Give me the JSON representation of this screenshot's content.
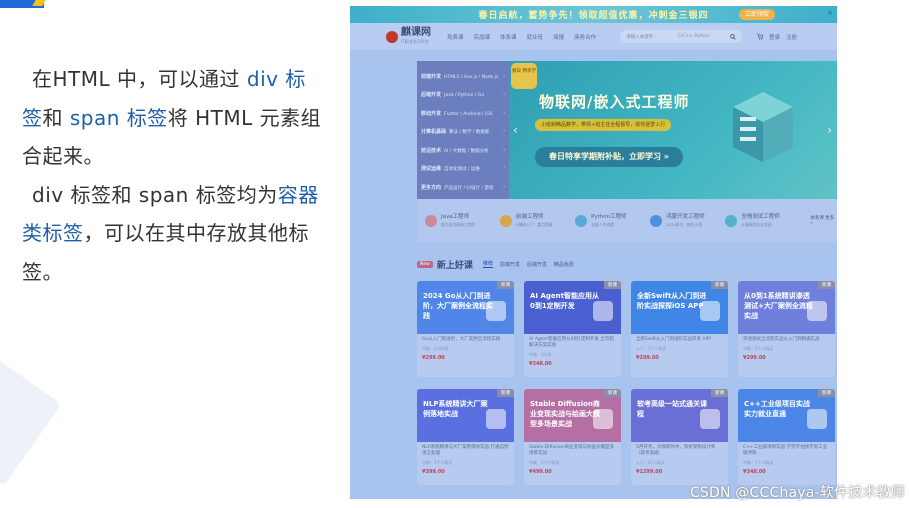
{
  "text_block": {
    "p1_a": "在HTML 中，可以通过 ",
    "p1_div": "div 标签",
    "p1_b": "和 ",
    "p1_span": "span 标签",
    "p1_c": "将 HTML 元素组合起来。",
    "p2_a": "div 标签和 span 标签均为",
    "p2_hl": "容器类标签",
    "p2_b": "，可以在其中存放其他标签。"
  },
  "screenshot": {
    "promo": {
      "text": "春日启航，蓄势争先！领取超值优惠，冲刺金三银四",
      "button": "立即领取",
      "close": "×"
    },
    "nav": {
      "logo": "麒课网",
      "logo_sub": "IT职业学习平台",
      "items": [
        "免费课",
        "实战课",
        "体系课",
        "就业班",
        "简报",
        "商务合作"
      ],
      "search_placeholder": "请输入关键字...",
      "search_hint": "C/C++ Python",
      "right": [
        "登录",
        "注册"
      ]
    },
    "side_menu": [
      {
        "title": "前端开发",
        "sub": "HTML5 / Vue.js / Node.js"
      },
      {
        "title": "后端开发",
        "sub": "Java / Python / Go"
      },
      {
        "title": "移动开发",
        "sub": "Flutter / Android / iOS"
      },
      {
        "title": "计算机基础",
        "sub": "算法 / 数学 / 数据库"
      },
      {
        "title": "前沿技术",
        "sub": "AI / 大数据 / 数据分析"
      },
      {
        "title": "测试运维",
        "sub": "自动化测试 / 运维"
      },
      {
        "title": "更多方向",
        "sub": "产品设计 / UI设计 / 游戏"
      }
    ],
    "banner": {
      "badge": "春日 特享学",
      "title": "物联网/嵌入式工程师",
      "subtitle": "小班制精品教学，带领+班主任全程督导，助你逐梦入行",
      "button": "春日特享学期附补贴，立即学习 »",
      "arrow_left": "‹",
      "arrow_right": "›"
    },
    "categories": [
      {
        "title": "Java工程师",
        "sub": "助力成为高级工程师",
        "color": "#c98a9e"
      },
      {
        "title": "前端工程师",
        "sub": "0基础入门 · 重点提高",
        "color": "#d9a54b"
      },
      {
        "title": "Python工程师",
        "sub": "全能人才成就",
        "color": "#5aa7d8"
      },
      {
        "title": "鸿蒙开发工程师",
        "sub": "2024风口 · 抢先入局",
        "color": "#4f8fe0"
      },
      {
        "title": "全栈测试工程师",
        "sub": "从基础到企业实战",
        "color": "#4fb3c9"
      }
    ],
    "categories_more": "体系课 更多 »",
    "section": {
      "tag": "New",
      "title": "新上好课",
      "tabs": [
        "推荐",
        "前端开发",
        "后端开发",
        "精品免费"
      ]
    },
    "cards": [
      {
        "title": "2024 Go从入门到进阶，大厂案例全流程实践",
        "desc": "Go从入门到进阶，大厂案例全流程实践",
        "meta": "中级 · 2小时前",
        "price": "¥299.00",
        "badge": "新课",
        "color": "#4f86e8"
      },
      {
        "title": "AI Agent智能应用从0到1定制开发",
        "desc": "AI Agent智能应用从0到1定制开发 全流程解决方案实践",
        "meta": "中级 · 1天前",
        "price": "¥348.00",
        "badge": "新课",
        "color": "#4a5fd0"
      },
      {
        "title": "全新Swift从入门到进阶实战探探iOS APP",
        "desc": "全新Swift从入门到进阶实战开发 APP",
        "meta": "入门 · 1个人购买",
        "price": "¥299.00",
        "badge": "新课",
        "color": "#3f86e6"
      },
      {
        "title": "从0到1系统精讲渗透测试+大厂案例全流程实战",
        "desc": "渗透测试全流程实战从入门到精通实战",
        "meta": "中级 · 3个人购买",
        "price": "¥299.00",
        "badge": "新课",
        "color": "#6f7fdc"
      },
      {
        "title": "NLP系统精讲大厂案例落地实战",
        "desc": "NLP系统精讲与大厂案例落地实战 打通自然语言处理",
        "meta": "中级 · 1个人购买",
        "price": "¥399.00",
        "badge": "新课",
        "color": "#5a70e0"
      },
      {
        "title": "Stable Diffusion商业变现实战与绘画大模型多场景实战",
        "desc": "Stable Diffusion商业变现与绘画大模型多场景实战",
        "meta": "中级 · 1个人购买",
        "price": "¥499.00",
        "badge": "新课",
        "color": "#b66fa5"
      },
      {
        "title": "软考高级一站式通关课程",
        "desc": "5月开考，大咖帮你冲，系统架构设计师（软考高级）",
        "meta": "入门 · 27人购买",
        "price": "¥1299.00",
        "badge": "新课",
        "color": "#6a6fd6"
      },
      {
        "title": "C++工业级项目实战实力就业直通",
        "desc": "C++工业级项目实战 学完不怕找不到工业级项目",
        "meta": "中级 · 1个人购买",
        "price": "¥348.00",
        "badge": "新课",
        "color": "#4c86e6"
      }
    ]
  },
  "watermark": "CSDN @CCChaya-软件技术教师"
}
